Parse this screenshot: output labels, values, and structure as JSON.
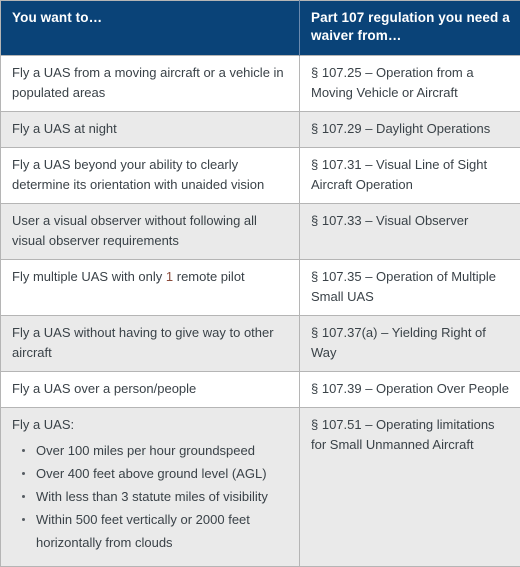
{
  "table": {
    "headers": {
      "left": "You want to…",
      "right": "Part 107 regulation you need a waiver from…"
    },
    "colors": {
      "header_background": "#0a4378",
      "header_text": "#ffffff",
      "row_alt_background": "#eaeaea",
      "row_background": "#ffffff",
      "border": "#b5b5b5",
      "body_text": "#3a4248",
      "highlight_number": "#8a4a3a"
    },
    "rows": [
      {
        "want_to": "Fly a UAS from a moving aircraft or a vehicle in populated areas",
        "regulation": "§ 107.25 – Operation from a Moving Vehicle or Aircraft"
      },
      {
        "want_to": "Fly a UAS at night",
        "regulation": "§ 107.29 – Daylight Operations"
      },
      {
        "want_to": "Fly a UAS beyond your ability to clearly determine its orientation with unaided vision",
        "regulation": "§ 107.31 – Visual Line of Sight Aircraft Operation"
      },
      {
        "want_to": "User a visual observer without following all visual observer requirements",
        "regulation": "§ 107.33 – Visual Observer"
      },
      {
        "want_to_prefix": "Fly multiple UAS with only ",
        "want_to_highlight": "1",
        "want_to_suffix": " remote pilot",
        "regulation": "§ 107.35 – Operation of Multiple Small UAS"
      },
      {
        "want_to": "Fly a UAS without having to give way to other aircraft",
        "regulation": "§ 107.37(a) – Yielding Right of Way"
      },
      {
        "want_to": "Fly a UAS over a person/people",
        "regulation": "§ 107.39 – Operation Over People"
      },
      {
        "want_to": "Fly a UAS:",
        "bullets": [
          "Over 100 miles per hour groundspeed",
          "Over 400 feet above ground level (AGL)",
          "With less than 3 statute miles of visibility",
          "Within 500 feet vertically or 2000 feet horizontally from clouds"
        ],
        "regulation": "§ 107.51 – Operating limitations for Small Unmanned Aircraft"
      }
    ]
  }
}
